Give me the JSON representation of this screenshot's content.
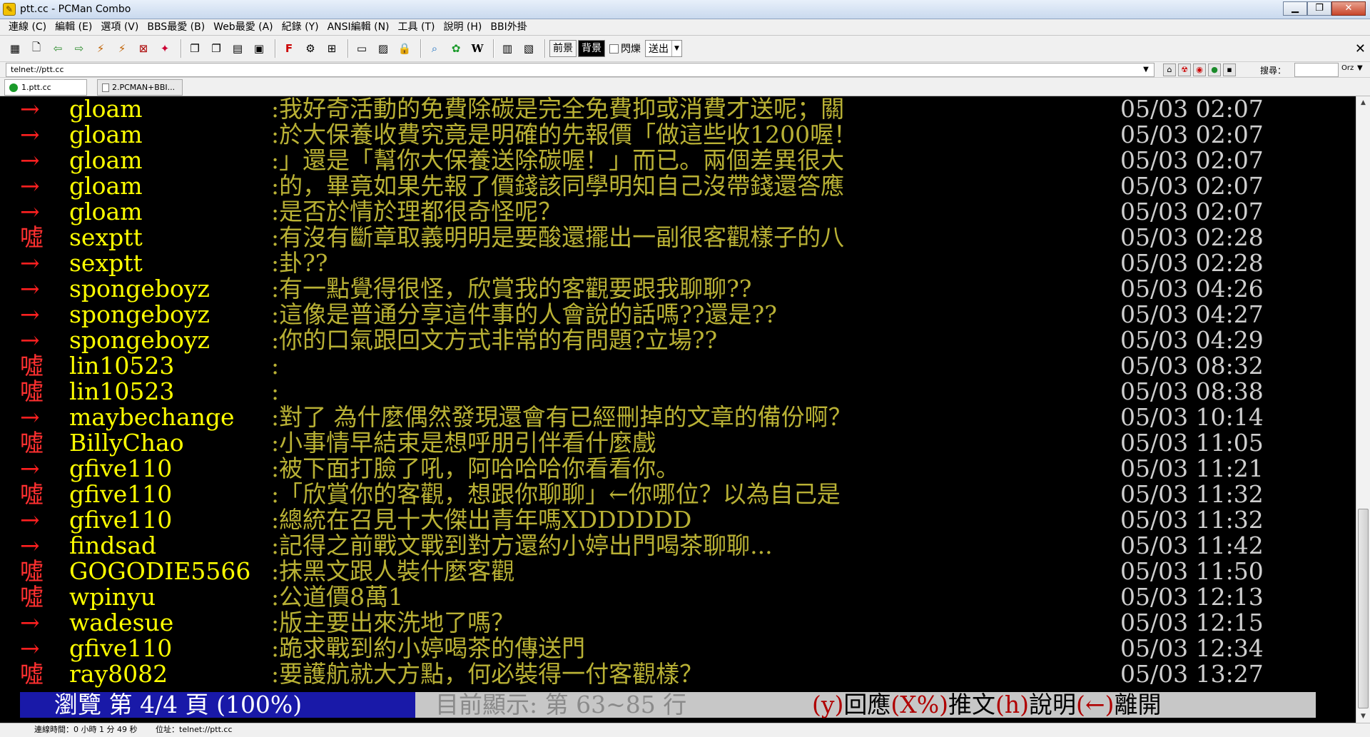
{
  "window": {
    "title": "ptt.cc - PCMan Combo",
    "app_icon_glyph": "✎",
    "buttons": {
      "minimize": "▁",
      "maximize": "❐",
      "close": "✕"
    }
  },
  "menu": [
    "連線 (C)",
    "編輯 (E)",
    "選項 (V)",
    "BBS最愛 (B)",
    "Web最愛 (A)",
    "紀錄 (Y)",
    "ANSI編輯 (N)",
    "工具 (T)",
    "說明 (H)",
    "BBI外掛"
  ],
  "toolbar": {
    "fg_label": "前景",
    "bg_label": "背景",
    "blink_label": "閃爍",
    "send_label": "送出",
    "close_glyph": "✕"
  },
  "address": {
    "url": "telnet://ptt.cc",
    "search_label": "搜尋：",
    "search_engine": "Orz"
  },
  "tabs": [
    {
      "label": "1.ptt.cc"
    },
    {
      "label": "2.PCMAN+BBI..."
    }
  ],
  "rows": [
    {
      "tag": "→",
      "kind": "arrow",
      "user": "gloam",
      "msg": ":我好奇活動的免費除碳是完全免費抑或消費才送呢；關",
      "time": "05/03 02:07"
    },
    {
      "tag": "→",
      "kind": "arrow",
      "user": "gloam",
      "msg": ":於大保養收費究竟是明確的先報價「做這些收1200喔！",
      "time": "05/03 02:07"
    },
    {
      "tag": "→",
      "kind": "arrow",
      "user": "gloam",
      "msg": ":」還是「幫你大保養送除碳喔！」而已。兩個差異很大",
      "time": "05/03 02:07"
    },
    {
      "tag": "→",
      "kind": "arrow",
      "user": "gloam",
      "msg": ":的，畢竟如果先報了價錢該同學明知自己沒帶錢還答應",
      "time": "05/03 02:07"
    },
    {
      "tag": "→",
      "kind": "arrow",
      "user": "gloam",
      "msg": ":是否於情於理都很奇怪呢？",
      "time": "05/03 02:07"
    },
    {
      "tag": "噓",
      "kind": "boo",
      "user": "sexptt",
      "msg": ":有沒有斷章取義明明是要酸還擺出一副很客觀樣子的八",
      "time": "05/03 02:28"
    },
    {
      "tag": "→",
      "kind": "arrow",
      "user": "sexptt",
      "msg": ":卦??",
      "time": "05/03 02:28"
    },
    {
      "tag": "→",
      "kind": "arrow",
      "user": "spongeboyz",
      "msg": ":有一點覺得很怪，欣賞我的客觀要跟我聊聊??",
      "time": "05/03 04:26"
    },
    {
      "tag": "→",
      "kind": "arrow",
      "user": "spongeboyz",
      "msg": ":這像是普通分享這件事的人會說的話嗎??還是??",
      "time": "05/03 04:27"
    },
    {
      "tag": "→",
      "kind": "arrow",
      "user": "spongeboyz",
      "msg": ":你的口氣跟回文方式非常的有問題?立場??",
      "time": "05/03 04:29"
    },
    {
      "tag": "噓",
      "kind": "boo",
      "user": "lin10523",
      "msg": ":",
      "time": "05/03 08:32"
    },
    {
      "tag": "噓",
      "kind": "boo",
      "user": "lin10523",
      "msg": ":",
      "time": "05/03 08:38"
    },
    {
      "tag": "→",
      "kind": "arrow",
      "user": "maybechange",
      "msg": ":對了 為什麼偶然發現還會有已經刪掉的文章的備份啊？",
      "time": "05/03 10:14"
    },
    {
      "tag": "噓",
      "kind": "boo",
      "user": "BillyChao",
      "msg": ":小事情早結束是想呼朋引伴看什麼戲",
      "time": "05/03 11:05"
    },
    {
      "tag": "→",
      "kind": "arrow",
      "user": "gfive110",
      "msg": ":被下面打臉了吼，阿哈哈哈你看看你。",
      "time": "05/03 11:21"
    },
    {
      "tag": "噓",
      "kind": "boo",
      "user": "gfive110",
      "msg": ":「欣賞你的客觀，想跟你聊聊」←你哪位？以為自己是",
      "time": "05/03 11:32"
    },
    {
      "tag": "→",
      "kind": "arrow",
      "user": "gfive110",
      "msg": ":總統在召見十大傑出青年嗎XDDDDDD",
      "time": "05/03 11:32"
    },
    {
      "tag": "→",
      "kind": "arrow",
      "user": "findsad",
      "msg": ":記得之前戰文戰到對方還約小婷出門喝茶聊聊...",
      "time": "05/03 11:42"
    },
    {
      "tag": "噓",
      "kind": "boo",
      "user": "GOGODIE5566",
      "msg": ":抹黑文跟人裝什麼客觀",
      "time": "05/03 11:50"
    },
    {
      "tag": "噓",
      "kind": "boo",
      "user": "wpinyu",
      "msg": ":公道價8萬1",
      "time": "05/03 12:13"
    },
    {
      "tag": "→",
      "kind": "arrow",
      "user": "wadesue",
      "msg": ":版主要出來洗地了嗎？",
      "time": "05/03 12:15"
    },
    {
      "tag": "→",
      "kind": "arrow",
      "user": "gfive110",
      "msg": ":跪求戰到約小婷喝茶的傳送門",
      "time": "05/03 12:34"
    },
    {
      "tag": "噓",
      "kind": "boo",
      "user": "ray8082",
      "msg": ":要護航就大方點，何必裝得一付客觀樣？",
      "time": "05/03 13:27"
    }
  ],
  "status": {
    "left": "瀏覽 第 4/4 頁 (100%)",
    "showing": "目前顯示: 第 63~85 行",
    "k1": "(y)",
    "t1": "回應",
    "k2": "(X%)",
    "t2": "推文",
    "k3": "(h)",
    "t3": "說明",
    "k4": "(←)",
    "t4": "離開"
  },
  "statusbar": {
    "conn_time": "連線時間：0 小時 1 分 49 秒",
    "address": "位址：telnet://ptt.cc"
  },
  "scroll": {
    "position_fraction": 1.0
  },
  "colors": {
    "terminal_bg": "#000000",
    "arrow_tag": "#ff2020",
    "user": "#ffff00",
    "message": "#b9b135",
    "time": "#cfcfcf",
    "status_left_bg": "#1919a8",
    "status_right_bg": "#c7c7c7"
  }
}
